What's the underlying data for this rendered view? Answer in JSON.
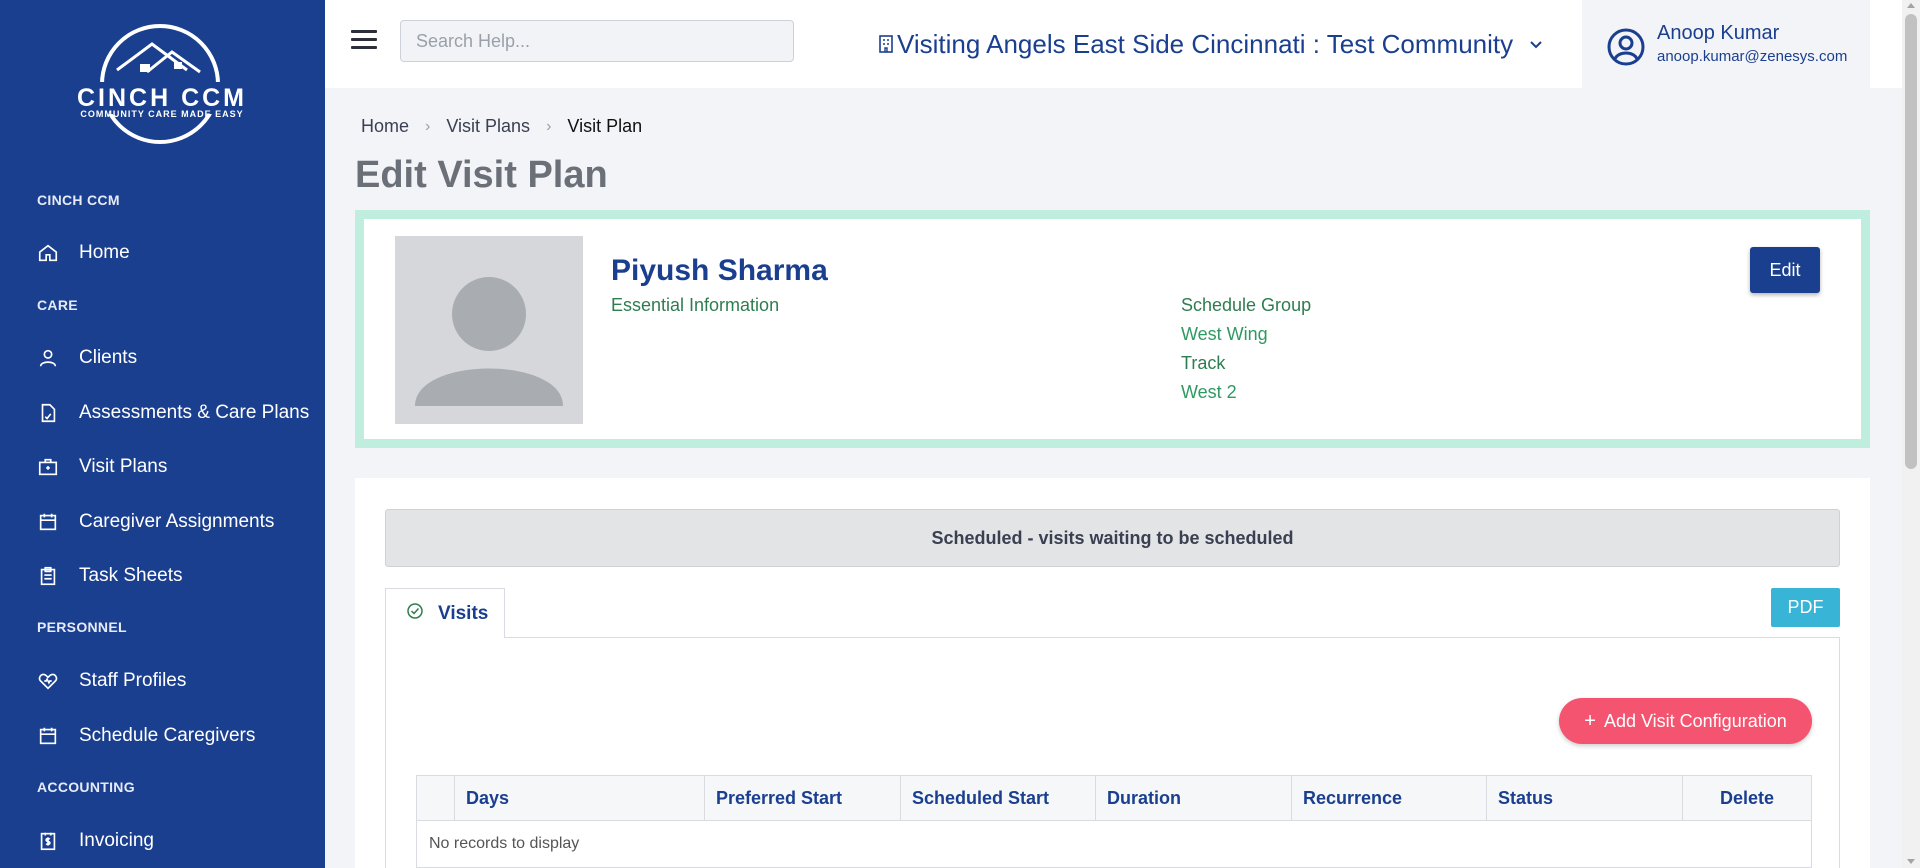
{
  "brand": {
    "name": "CINCH CCM",
    "tagline": "COMMUNITY CARE MADE EASY"
  },
  "sidebar": {
    "sections": [
      {
        "title": "CINCH CCM",
        "items": [
          {
            "label": "Home",
            "icon": "home-icon"
          }
        ]
      },
      {
        "title": "CARE",
        "items": [
          {
            "label": "Clients",
            "icon": "user-icon"
          },
          {
            "label": "Assessments & Care Plans",
            "icon": "document-icon"
          },
          {
            "label": "Visit Plans",
            "icon": "briefcase-icon"
          },
          {
            "label": "Caregiver Assignments",
            "icon": "calendar-icon"
          },
          {
            "label": "Task Sheets",
            "icon": "clipboard-icon"
          }
        ]
      },
      {
        "title": "PERSONNEL",
        "items": [
          {
            "label": "Staff Profiles",
            "icon": "heart-icon"
          },
          {
            "label": "Schedule Caregivers",
            "icon": "calendar-icon"
          }
        ]
      },
      {
        "title": "ACCOUNTING",
        "items": [
          {
            "label": "Invoicing",
            "icon": "invoice-icon"
          }
        ]
      }
    ]
  },
  "topbar": {
    "search_placeholder": "Search Help...",
    "community": "Visiting Angels East Side Cincinnati : Test Community",
    "user": {
      "name": "Anoop Kumar",
      "email": "anoop.kumar@zenesys.com"
    }
  },
  "breadcrumb": {
    "home": "Home",
    "parent": "Visit Plans",
    "current": "Visit Plan"
  },
  "page_title": "Edit Visit Plan",
  "profile": {
    "name": "Piyush Sharma",
    "section": "Essential Information",
    "schedule_group_label": "Schedule Group",
    "schedule_group_value": "West Wing",
    "track_label": "Track",
    "track_value": "West 2",
    "edit_label": "Edit"
  },
  "status_text": "Scheduled - visits waiting to be scheduled",
  "tabs": [
    {
      "label": "Visits"
    }
  ],
  "pdf_label": "PDF",
  "add_visit_label": "Add Visit Configuration",
  "table": {
    "columns": [
      "",
      "Days",
      "Preferred Start",
      "Scheduled Start",
      "Duration",
      "Recurrence",
      "Status",
      "Delete"
    ],
    "empty_message": "No records to display"
  },
  "colors": {
    "sidebar_bg": "#1b3f8f",
    "card_border": "#bfeede",
    "accent_pink": "#f4546f",
    "pdf_blue": "#37b4d6"
  }
}
